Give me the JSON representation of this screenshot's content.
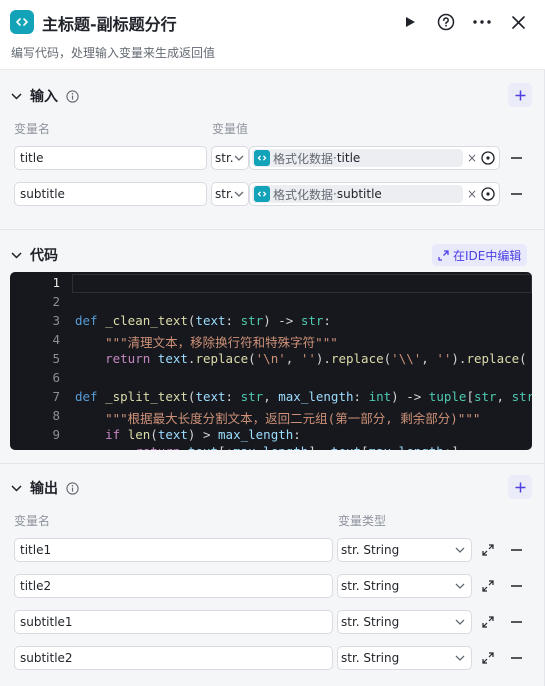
{
  "header": {
    "title": "主标题-副标题分行",
    "description": "编写代码，处理输入变量来生成返回值"
  },
  "inputs": {
    "section_title": "输入",
    "col_name": "变量名",
    "col_value": "变量值",
    "rows": [
      {
        "name": "title",
        "type": "str.",
        "ref_label": "格式化数据",
        "ref_sep": " · ",
        "ref_path": "title"
      },
      {
        "name": "subtitle",
        "type": "str.",
        "ref_label": "格式化数据",
        "ref_sep": " · ",
        "ref_path": "subtitle"
      }
    ]
  },
  "code": {
    "section_title": "代码",
    "ide_label": "在IDE中编辑",
    "line_numbers": [
      "1",
      "2",
      "3",
      "4",
      "5",
      "6",
      "7",
      "8",
      "9"
    ]
  },
  "outputs": {
    "section_title": "输出",
    "col_name": "变量名",
    "col_type": "变量类型",
    "rows": [
      {
        "name": "title1",
        "type": "str. String"
      },
      {
        "name": "title2",
        "type": "str. String"
      },
      {
        "name": "subtitle1",
        "type": "str. String"
      },
      {
        "name": "subtitle2",
        "type": "str. String"
      }
    ]
  },
  "colors": {
    "accent": "#4e40e5",
    "node_icon": "#12a3b8",
    "editor_bg": "#16181d"
  },
  "icons": {
    "node": "code-icon",
    "run": "play-icon",
    "help": "help-icon",
    "more": "more-icon",
    "close": "close-icon"
  }
}
